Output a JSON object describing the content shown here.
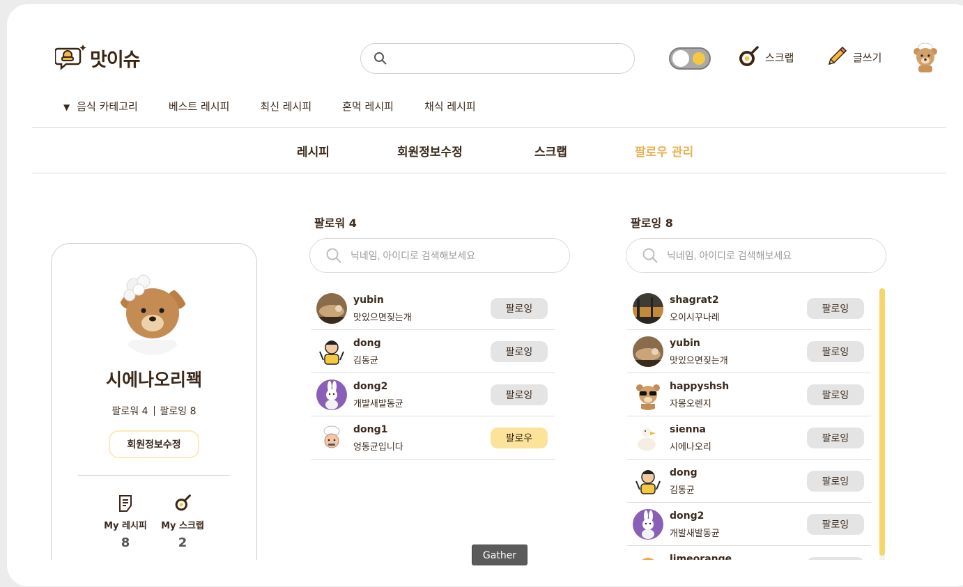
{
  "header": {
    "logo_text": "맛이슈",
    "search_placeholder": "",
    "scrap_label": "스크랩",
    "write_label": "글쓰기"
  },
  "category_nav": {
    "items": [
      "음식 카테고리",
      "베스트 레시피",
      "최신 레시피",
      "혼먹 레시피",
      "채식 레시피"
    ]
  },
  "subtabs": {
    "items": [
      "레시피",
      "회원정보수정",
      "스크랩",
      "팔로우 관리"
    ],
    "active_index": 3
  },
  "profile": {
    "nickname": "시에나오리꽥",
    "follower_label": "팔로워 4",
    "following_label": "팔로잉 8",
    "edit_button": "회원정보수정",
    "my_recipe_label": "My 레시피",
    "my_recipe_count": "8",
    "my_scrap_label": "My 스크랩",
    "my_scrap_count": "2"
  },
  "followers": {
    "title": "팔로워 4",
    "search_placeholder": "닉네임, 아이디로 검색해보세요",
    "items": [
      {
        "id": "yubin",
        "name": "맛있으면짖는개",
        "button": "팔로잉",
        "avatar": "fox-photo"
      },
      {
        "id": "dong",
        "name": "김동균",
        "button": "팔로잉",
        "avatar": "chef-cartoon"
      },
      {
        "id": "dong2",
        "name": "개발새발동균",
        "button": "팔로잉",
        "avatar": "rabbit-cartoon"
      },
      {
        "id": "dong1",
        "name": "엉동균입니다",
        "button": "팔로우",
        "avatar": "chef-hat-face"
      }
    ]
  },
  "following": {
    "title": "팔로잉 8",
    "search_placeholder": "닉네임, 아이디로 검색해보세요",
    "items": [
      {
        "id": "shagrat2",
        "name": "오이시꾸나레",
        "button": "팔로잉",
        "avatar": "landscape-photo"
      },
      {
        "id": "yubin",
        "name": "맛있으면짖는개",
        "button": "팔로잉",
        "avatar": "fox-photo"
      },
      {
        "id": "happyshsh",
        "name": "자몽오렌지",
        "button": "팔로잉",
        "avatar": "bear-sunglasses"
      },
      {
        "id": "sienna",
        "name": "시에나오리",
        "button": "팔로잉",
        "avatar": "duck-plush"
      },
      {
        "id": "dong",
        "name": "김동균",
        "button": "팔로잉",
        "avatar": "chef-cartoon"
      },
      {
        "id": "dong2",
        "name": "개발새발동균",
        "button": "팔로잉",
        "avatar": "rabbit-cartoon"
      },
      {
        "id": "limeorange",
        "name": "",
        "button": "팔로잉",
        "avatar": "orange-avatar"
      }
    ]
  },
  "tooltip": "Gather",
  "colors": {
    "accent": "#e9b04f",
    "follow_button": "#fbe49a",
    "following_button": "#e4e4e4",
    "text": "#3b2a1c"
  }
}
